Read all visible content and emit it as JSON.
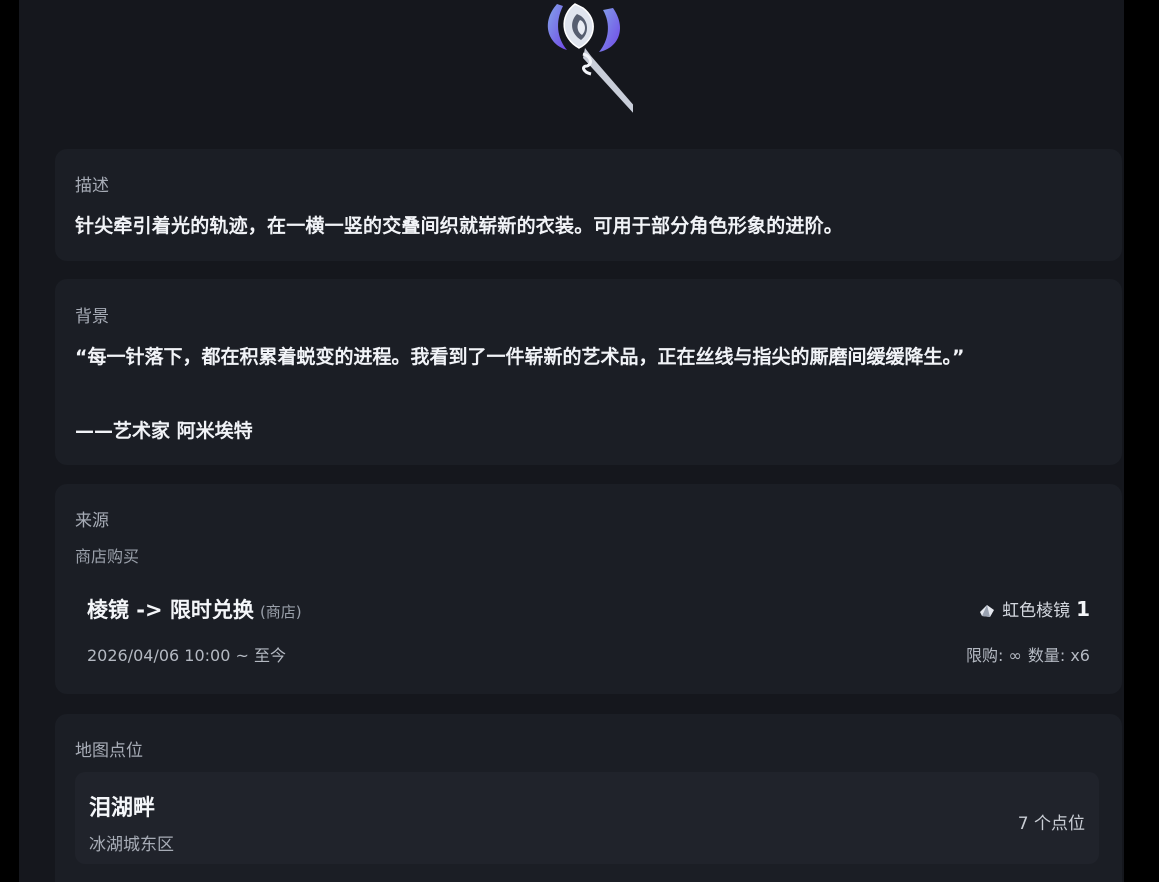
{
  "description": {
    "label": "描述",
    "text": "针尖牵引着光的轨迹，在一横一竖的交叠间织就崭新的衣装。可用于部分角色形象的进阶。"
  },
  "background": {
    "label": "背景",
    "quote": "“每一针落下，都在积累着蜕变的进程。我看到了一件崭新的艺术品，正在丝线与指尖的厮磨间缓缓降生。”",
    "author": "——艺术家 阿米埃特"
  },
  "source": {
    "label": "来源",
    "subtitle": "商店购买",
    "entry": {
      "title": "棱镜 -> 限时兑换",
      "tag": "(商店)",
      "period": "2026/04/06 10:00 ~ 至今",
      "cost_icon": "prism-gem-icon",
      "cost_currency": "虹色棱镜",
      "cost_amount": "1",
      "limit": "限购: ∞",
      "quantity": "数量: x6"
    }
  },
  "map_points": {
    "label": "地图点位",
    "locations": [
      {
        "name": "泪湖畔",
        "area": "冰湖城东区",
        "count": "7 个点位"
      }
    ]
  },
  "colors": {
    "background": "#15171d",
    "card": "#1b1e25",
    "accent": "#6b5cff"
  }
}
